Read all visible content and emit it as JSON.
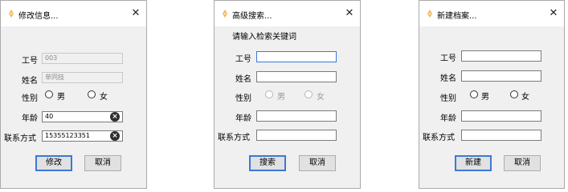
{
  "edit_dialog": {
    "title": "修改信息...",
    "close": "✕",
    "labels": {
      "id": "工号",
      "name": "姓名",
      "gender": "性别",
      "age": "年龄",
      "contact": "联系方式"
    },
    "values": {
      "id": "003",
      "name": "单同技",
      "age": "40",
      "contact": "15355123351"
    },
    "gender_options": [
      "男",
      "女"
    ],
    "buttons": {
      "primary": "修改",
      "cancel": "取消"
    }
  },
  "search_dialog": {
    "title": "高级搜索...",
    "close": "✕",
    "hint": "请输入检索关键词",
    "labels": {
      "id": "工号",
      "name": "姓名",
      "gender": "性别",
      "age": "年龄",
      "contact": "联系方式"
    },
    "gender_options": [
      "男",
      "女"
    ],
    "buttons": {
      "primary": "搜索",
      "cancel": "取消"
    }
  },
  "new_dialog": {
    "title": "新建档案...",
    "close": "✕",
    "labels": {
      "id": "工号",
      "name": "姓名",
      "gender": "性别",
      "age": "年龄",
      "contact": "联系方式"
    },
    "gender_options": [
      "男",
      "女"
    ],
    "buttons": {
      "primary": "新建",
      "cancel": "取消"
    }
  },
  "icons": {
    "app": "app-logo-icon",
    "clear": "clear-input-icon",
    "close": "close-icon"
  },
  "colors": {
    "accent": "#3b78d8",
    "dialog_bg": "#f0f0f0",
    "button_bg": "#e1e1e1"
  }
}
